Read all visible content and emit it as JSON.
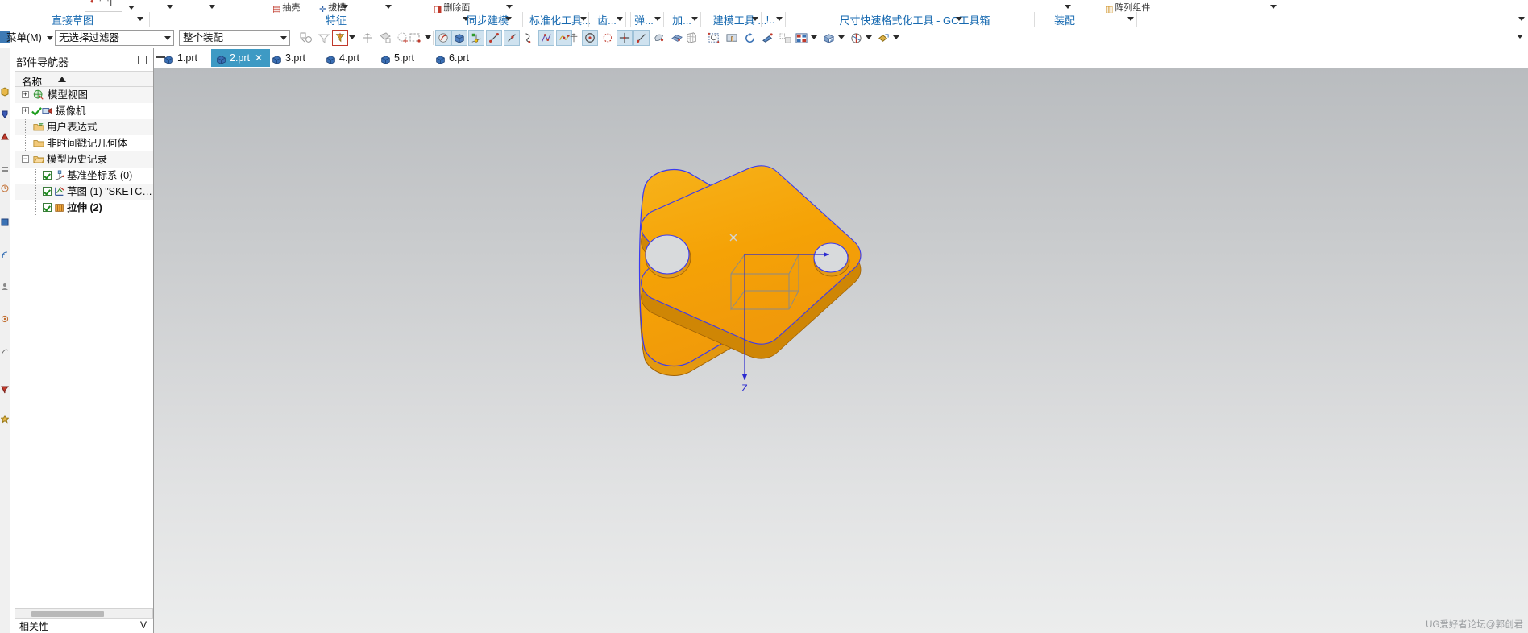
{
  "app": {
    "watermark": "UG爱好者论坛@郭创君"
  },
  "ribbon": {
    "icon_labels": [
      "抽壳",
      "拔模",
      "删除面",
      "阵列组件"
    ],
    "groups": [
      {
        "label": "直接草图",
        "dropdown": "▾"
      },
      {
        "label": "特征",
        "dropdown": "▾"
      },
      {
        "label": "同步建模",
        "dropdown": "▾"
      },
      {
        "label": "标准化工具...",
        "dropdown": "▾"
      },
      {
        "label": "齿...",
        "dropdown": "▾"
      },
      {
        "label": "弹...",
        "dropdown": "▾"
      },
      {
        "label": "加...",
        "dropdown": "▾"
      },
      {
        "label": "建模工具 ...",
        "dropdown": "▾"
      },
      {
        "label": "!..",
        "dropdown": "▾"
      },
      {
        "label": "尺寸快速格式化工具 - GC工具箱",
        "dropdown": "▾"
      },
      {
        "label": "装配",
        "dropdown": "▾"
      },
      {
        "label": "",
        "dropdown": "▾"
      }
    ]
  },
  "toolbar": {
    "menu_label": "菜单(M)",
    "menu_mnemonic": "M",
    "selection_filter": "无选择过滤器",
    "scope_filter": "整个装配",
    "icons": [
      {
        "name": "select-general-icon"
      },
      {
        "name": "filter-icon"
      },
      {
        "name": "selection-filter-active-icon"
      },
      {
        "name": "datum-icon"
      },
      {
        "name": "face-select-icon"
      },
      {
        "name": "feature-select-icon"
      },
      {
        "name": "rectangle-select-icon"
      },
      {
        "name": "shaded-display-icon"
      },
      {
        "name": "solid-body-icon"
      },
      {
        "name": "datum-csys-icon"
      },
      {
        "name": "line-icon"
      },
      {
        "name": "line2-icon"
      },
      {
        "name": "arc-icon"
      },
      {
        "name": "spline-polyline-icon"
      },
      {
        "name": "studio-spline-icon"
      },
      {
        "name": "point-cross-icon"
      },
      {
        "name": "circle-icon"
      },
      {
        "name": "circle-dashed-icon"
      },
      {
        "name": "cross-point-icon"
      },
      {
        "name": "line-red-icon"
      },
      {
        "name": "sketch-curve-icon"
      },
      {
        "name": "surface-icon"
      },
      {
        "name": "grid-icon"
      },
      {
        "name": "zoom-window-icon"
      },
      {
        "name": "pan-icon"
      },
      {
        "name": "rotate-icon"
      },
      {
        "name": "fit-view-icon"
      },
      {
        "name": "layout-icon"
      },
      {
        "name": "render-style-icon"
      }
    ]
  },
  "navigator": {
    "title": "部件导航器",
    "column_header": "名称",
    "sort_direction": "ascending",
    "tree": [
      {
        "label": "模型视图",
        "depth": 0,
        "expander": "+",
        "checkbox": false,
        "check2": false,
        "icon": "model-views-icon"
      },
      {
        "label": "摄像机",
        "depth": 0,
        "expander": "+",
        "checkbox": false,
        "check2": true,
        "icon": "camera-icon"
      },
      {
        "label": "用户表达式",
        "depth": 0,
        "expander": "",
        "checkbox": false,
        "check2": false,
        "icon": "folder-icon"
      },
      {
        "label": "非时间戳记几何体",
        "depth": 0,
        "expander": "",
        "checkbox": false,
        "check2": false,
        "icon": "folder-icon"
      },
      {
        "label": "模型历史记录",
        "depth": 0,
        "expander": "−",
        "checkbox": false,
        "check2": false,
        "icon": "folder-open-icon"
      },
      {
        "label": "基准坐标系 (0)",
        "depth": 1,
        "expander": "",
        "checkbox": true,
        "check2": false,
        "icon": "datum-csys-icon"
      },
      {
        "label": "草图 (1) \"SKETC…",
        "depth": 1,
        "expander": "",
        "checkbox": true,
        "check2": false,
        "icon": "sketch-icon"
      },
      {
        "label": "拉伸 (2)",
        "depth": 1,
        "expander": "",
        "checkbox": true,
        "check2": false,
        "icon": "extrude-icon",
        "bold": true
      }
    ],
    "footer_label": "相关性",
    "footer_value": "V"
  },
  "tabs": [
    {
      "label": "1.prt",
      "active": false,
      "closable": false
    },
    {
      "label": "2.prt",
      "active": true,
      "closable": true
    },
    {
      "label": "3.prt",
      "active": false,
      "closable": false
    },
    {
      "label": "4.prt",
      "active": false,
      "closable": false
    },
    {
      "label": "5.prt",
      "active": false,
      "closable": false
    },
    {
      "label": "6.prt",
      "active": false,
      "closable": false
    }
  ],
  "viewport": {
    "model_name": "extruded-plate",
    "body_color": "#f5a300",
    "edge_color": "#3a3af0",
    "axis_label_z": "Z",
    "axis_color": "#2a2ad0",
    "background_top": "#b9bcbf",
    "background_bottom": "#eceded"
  }
}
